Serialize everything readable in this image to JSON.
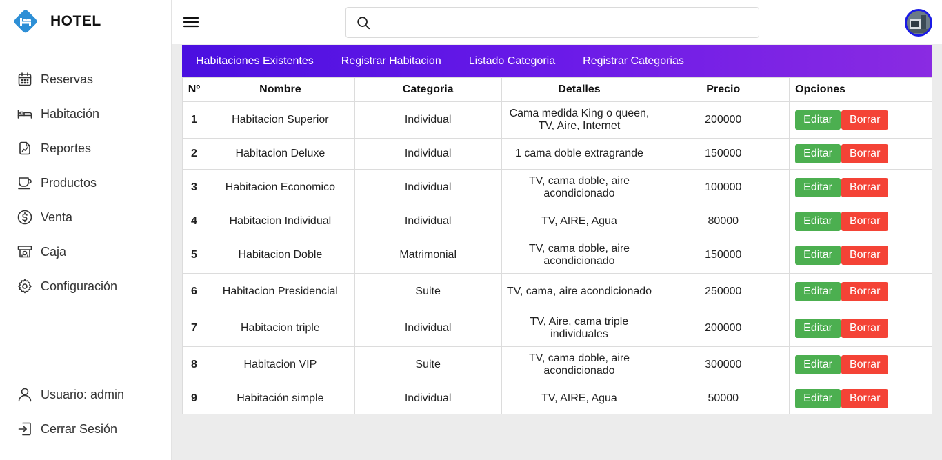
{
  "brand": {
    "name": "HOTEL"
  },
  "sidebar": {
    "items": [
      {
        "label": "Reservas",
        "icon": "calendar-icon"
      },
      {
        "label": "Habitación",
        "icon": "bed-icon"
      },
      {
        "label": "Reportes",
        "icon": "report-icon"
      },
      {
        "label": "Productos",
        "icon": "cup-icon"
      },
      {
        "label": "Venta",
        "icon": "dollar-icon"
      },
      {
        "label": "Caja",
        "icon": "register-icon"
      },
      {
        "label": "Configuración",
        "icon": "gear-icon"
      }
    ],
    "user_label": "Usuario: admin",
    "logout_label": "Cerrar Sesión"
  },
  "search": {
    "value": "",
    "placeholder": ""
  },
  "tabs": [
    {
      "label": "Habitaciones Existentes"
    },
    {
      "label": "Registrar Habitacion"
    },
    {
      "label": "Listado Categoria"
    },
    {
      "label": "Registrar Categorias"
    }
  ],
  "table": {
    "headers": [
      "Nº",
      "Nombre",
      "Categoria",
      "Detalles",
      "Precio",
      "Opciones"
    ],
    "edit_label": "Editar",
    "delete_label": "Borrar",
    "rows": [
      {
        "n": "1",
        "nombre": "Habitacion Superior",
        "categoria": "Individual",
        "detalles": "Cama medida King o queen, TV, Aire, Internet",
        "precio": "200000"
      },
      {
        "n": "2",
        "nombre": "Habitacion Deluxe",
        "categoria": "Individual",
        "detalles": "1 cama doble extragrande",
        "precio": "150000"
      },
      {
        "n": "3",
        "nombre": "Habitacion Economico",
        "categoria": "Individual",
        "detalles": "TV, cama doble, aire acondicionado",
        "precio": "100000"
      },
      {
        "n": "4",
        "nombre": "Habitacion Individual",
        "categoria": "Individual",
        "detalles": "TV, AIRE, Agua",
        "precio": "80000"
      },
      {
        "n": "5",
        "nombre": "Habitacion Doble",
        "categoria": "Matrimonial",
        "detalles": "TV, cama doble, aire acondicionado",
        "precio": "150000"
      },
      {
        "n": "6",
        "nombre": "Habitacion Presidencial",
        "categoria": "Suite",
        "detalles": "TV, cama, aire acondicionado",
        "precio": "250000"
      },
      {
        "n": "7",
        "nombre": "Habitacion triple",
        "categoria": "Individual",
        "detalles": "TV, Aire, cama triple individuales",
        "precio": "200000"
      },
      {
        "n": "8",
        "nombre": "Habitacion VIP",
        "categoria": "Suite",
        "detalles": "TV, cama doble, aire acondicionado",
        "precio": "300000"
      },
      {
        "n": "9",
        "nombre": "Habitación simple",
        "categoria": "Individual",
        "detalles": "TV, AIRE, Agua",
        "precio": "50000"
      }
    ]
  },
  "colors": {
    "tabbar_start": "#4a0fe0",
    "tabbar_end": "#8a2be2",
    "edit_button": "#4caf50",
    "delete_button": "#f44336",
    "logo": "#2d8fd6",
    "avatar_border": "#1a1ae6"
  }
}
